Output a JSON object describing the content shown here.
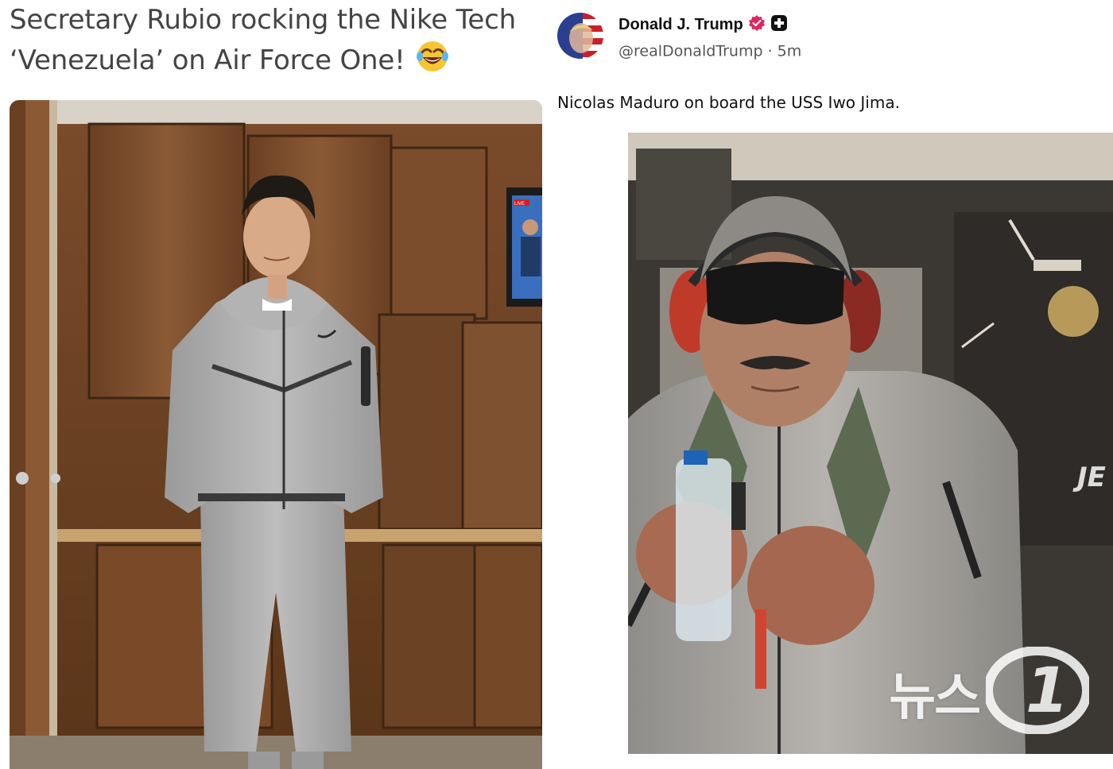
{
  "left_post": {
    "title_line1": "Secretary Rubio rocking the Nike Tech",
    "title_line2": "‘Venezuela’ on Air Force One!",
    "emoji": "face-with-tears-of-joy",
    "photo_tv_badge": "LIVE"
  },
  "right_post": {
    "author_name": "Donald J. Trump",
    "handle": "@realDonaldTrump",
    "separator": "·",
    "time": "5m",
    "text": "Nicolas Maduro on board the USS Iwo Jima.",
    "verified_color": "#e0245e",
    "photo_letters": "JE"
  },
  "watermark": {
    "text": "뉴스",
    "mark": "1"
  }
}
